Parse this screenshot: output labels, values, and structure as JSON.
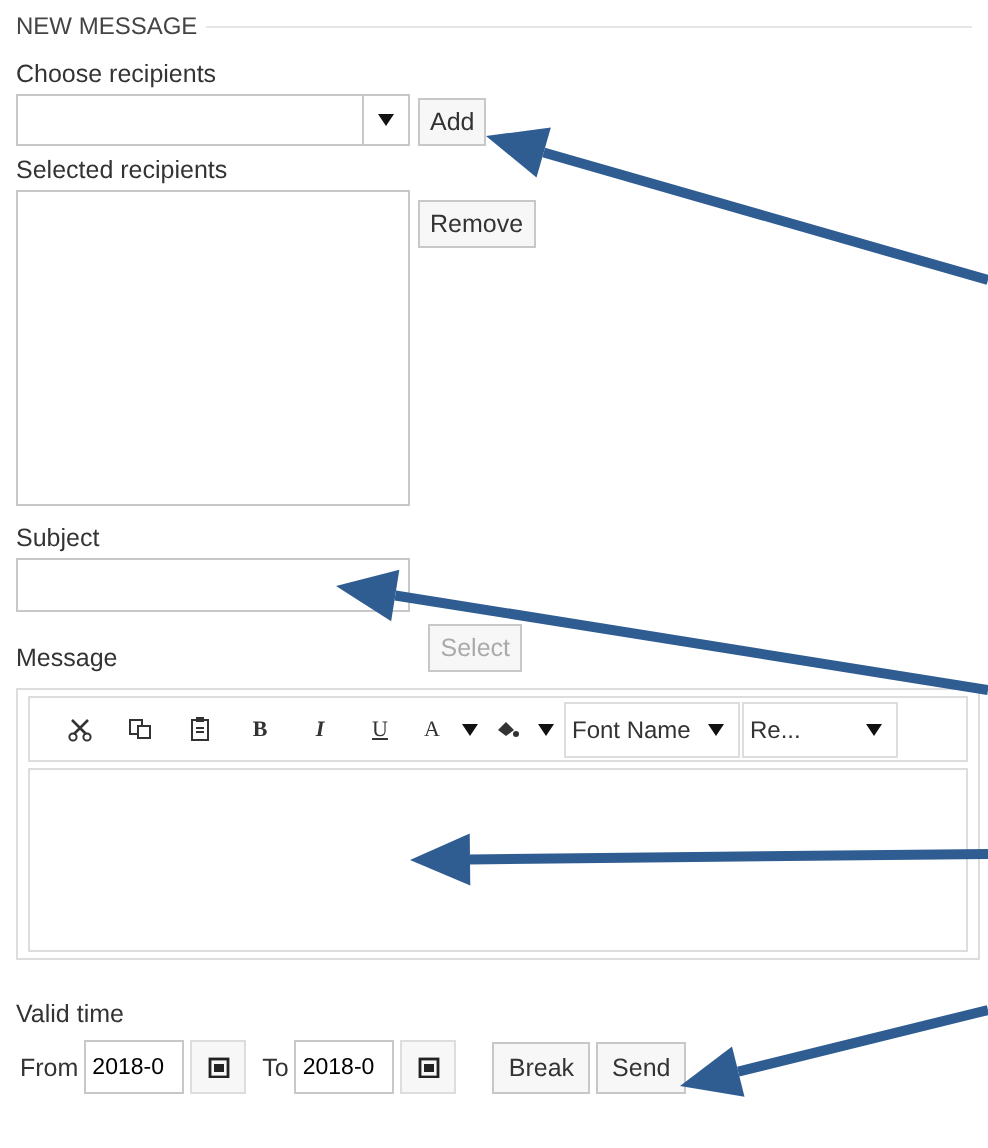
{
  "legend": "NEW MESSAGE",
  "recipients": {
    "label": "Choose recipients",
    "add_button": "Add"
  },
  "selected_recipients": {
    "label": "Selected recipients",
    "remove_button": "Remove"
  },
  "subject": {
    "label": "Subject"
  },
  "message": {
    "label": "Message",
    "select_button": "Select",
    "select_disabled": true,
    "toolbar": [
      {
        "kind": "cut"
      },
      {
        "kind": "copy"
      },
      {
        "kind": "paste"
      },
      {
        "kind": "bold",
        "label": "B"
      },
      {
        "kind": "italic",
        "label": "I"
      },
      {
        "kind": "underline",
        "label": "U"
      },
      {
        "kind": "fontcolor",
        "label": "A"
      },
      {
        "kind": "highlight"
      }
    ],
    "font_name": "Font Name",
    "font_size": "Re..."
  },
  "valid_time": {
    "label": "Valid time",
    "from_label": "From",
    "from_value": "2018-0",
    "to_label": "To",
    "to_value": "2018-0"
  },
  "buttons": [
    "Break",
    "Send"
  ]
}
